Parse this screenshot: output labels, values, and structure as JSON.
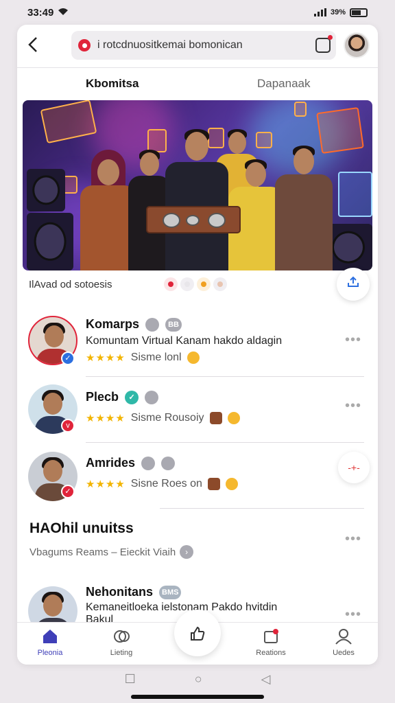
{
  "status_bar": {
    "time": "33:49",
    "battery": "39%"
  },
  "header": {
    "search_text": "i rotcdnuositkemai bomonican",
    "icons": [
      "back-icon",
      "record-icon",
      "camera-icon",
      "avatar"
    ]
  },
  "tabs": [
    {
      "label": "Kbomitsa",
      "active": true
    },
    {
      "label": "Dapanaak",
      "active": false
    }
  ],
  "hero": {
    "caption": "IlAvad od sotoesis",
    "dot_colors": [
      "#e0243a",
      "#e8e6ea",
      "#f0a020",
      "#e8e6ea"
    ]
  },
  "items": [
    {
      "name": "Komarps",
      "tags": [
        "",
        "BB"
      ],
      "desc": "Komuntam Virtual Kanam hakdo aldagin",
      "meta": "Sisme lonl",
      "rating": "★★★★"
    },
    {
      "name": "Plecb",
      "tags": [
        "",
        ""
      ],
      "desc": "",
      "meta": "Sisme Rousoiy",
      "rating": "★★★★"
    },
    {
      "name": "Amrides",
      "tags": [
        "",
        ""
      ],
      "desc": "",
      "meta": "Sisne Roes on",
      "rating": "★★★★"
    }
  ],
  "section": {
    "title": "HAOhil unuitss",
    "subtitle": "Vbagums  Reams  –  Eieckit Viaih"
  },
  "last_item": {
    "name": "Nehonitans",
    "tag": "BMS",
    "desc": "Kemaneitloeka ielstonam Pakdo hvitdin",
    "desc2": "Bakul"
  },
  "bottom_nav": [
    {
      "label": "Pleonia",
      "active": true
    },
    {
      "label": "Lieting",
      "active": false
    },
    {
      "label": "Reations",
      "active": false
    },
    {
      "label": "Uedes",
      "active": false
    }
  ],
  "colors": {
    "accent": "#3f3fb8",
    "red": "#e0243a",
    "star": "#f2b400"
  }
}
